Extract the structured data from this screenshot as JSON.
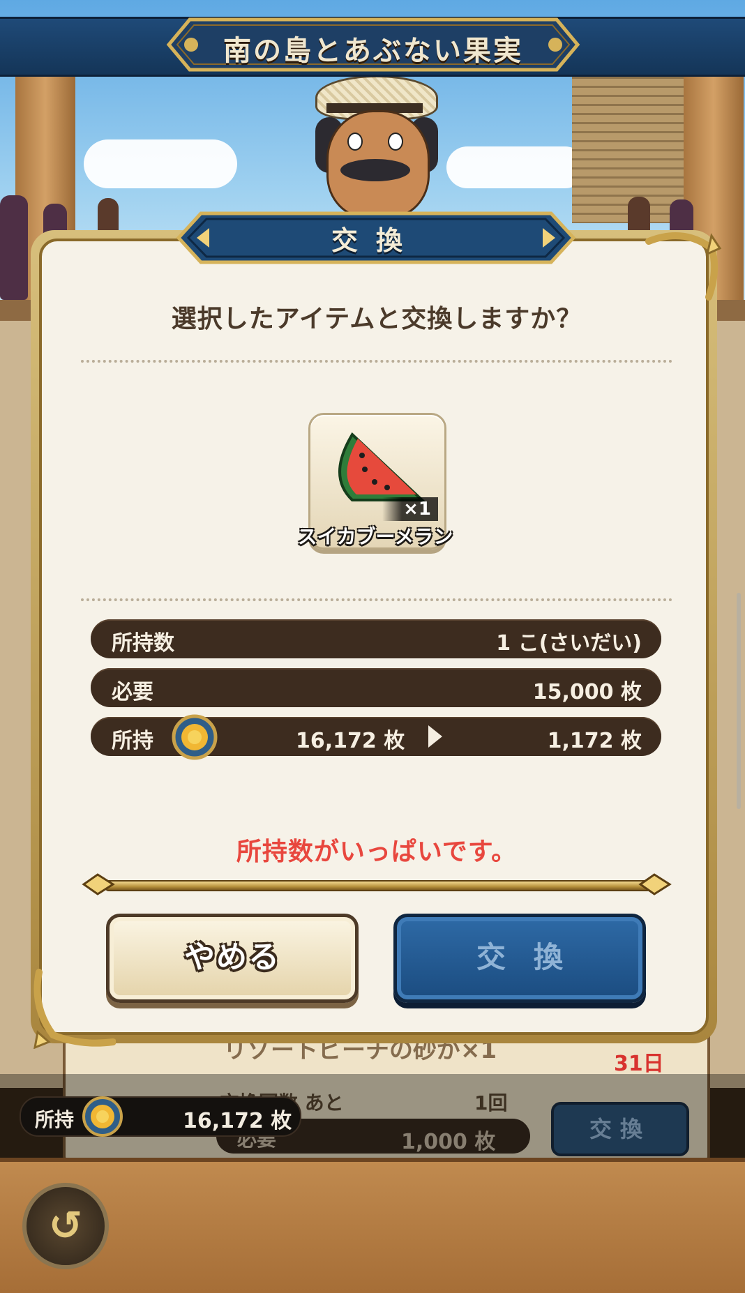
{
  "app": {
    "title": "南の島とあぶない果実"
  },
  "colors": {
    "accent_blue": "#1f4a78",
    "gold": "#c9a24a",
    "warning_red": "#e8473e",
    "row_dark": "#3d2c1f",
    "panel_cream": "#f6f2e8"
  },
  "background": {
    "card_title": "リゾートビーチの砂が×1",
    "days_left": "31日",
    "remaining_label": "交換回数 あと",
    "remaining_value": "1回",
    "need_label": "必要",
    "need_value": "1,000 枚",
    "exchange_label": "交換",
    "owned_label": "所持",
    "owned_value": "16,172 枚"
  },
  "dialog": {
    "title": "交換",
    "prompt": "選択したアイテムと交換しますか？",
    "item": {
      "name": "スイカブーメラン",
      "quantity": "×1",
      "icon": "watermelon-boomerang-icon"
    },
    "rows": [
      {
        "label": "所持数",
        "value": "1 こ(さいだい)"
      },
      {
        "label": "必要",
        "value": "15,000 枚"
      },
      {
        "label": "所持",
        "before": "16,172 枚",
        "after": "1,172 枚",
        "icon": "sun-medal-icon"
      }
    ],
    "warning": "所持数がいっぱいです。",
    "buttons": {
      "cancel": "やめる",
      "exchange": "交換"
    }
  },
  "nav": {
    "back_icon": "return-arrow-icon"
  }
}
